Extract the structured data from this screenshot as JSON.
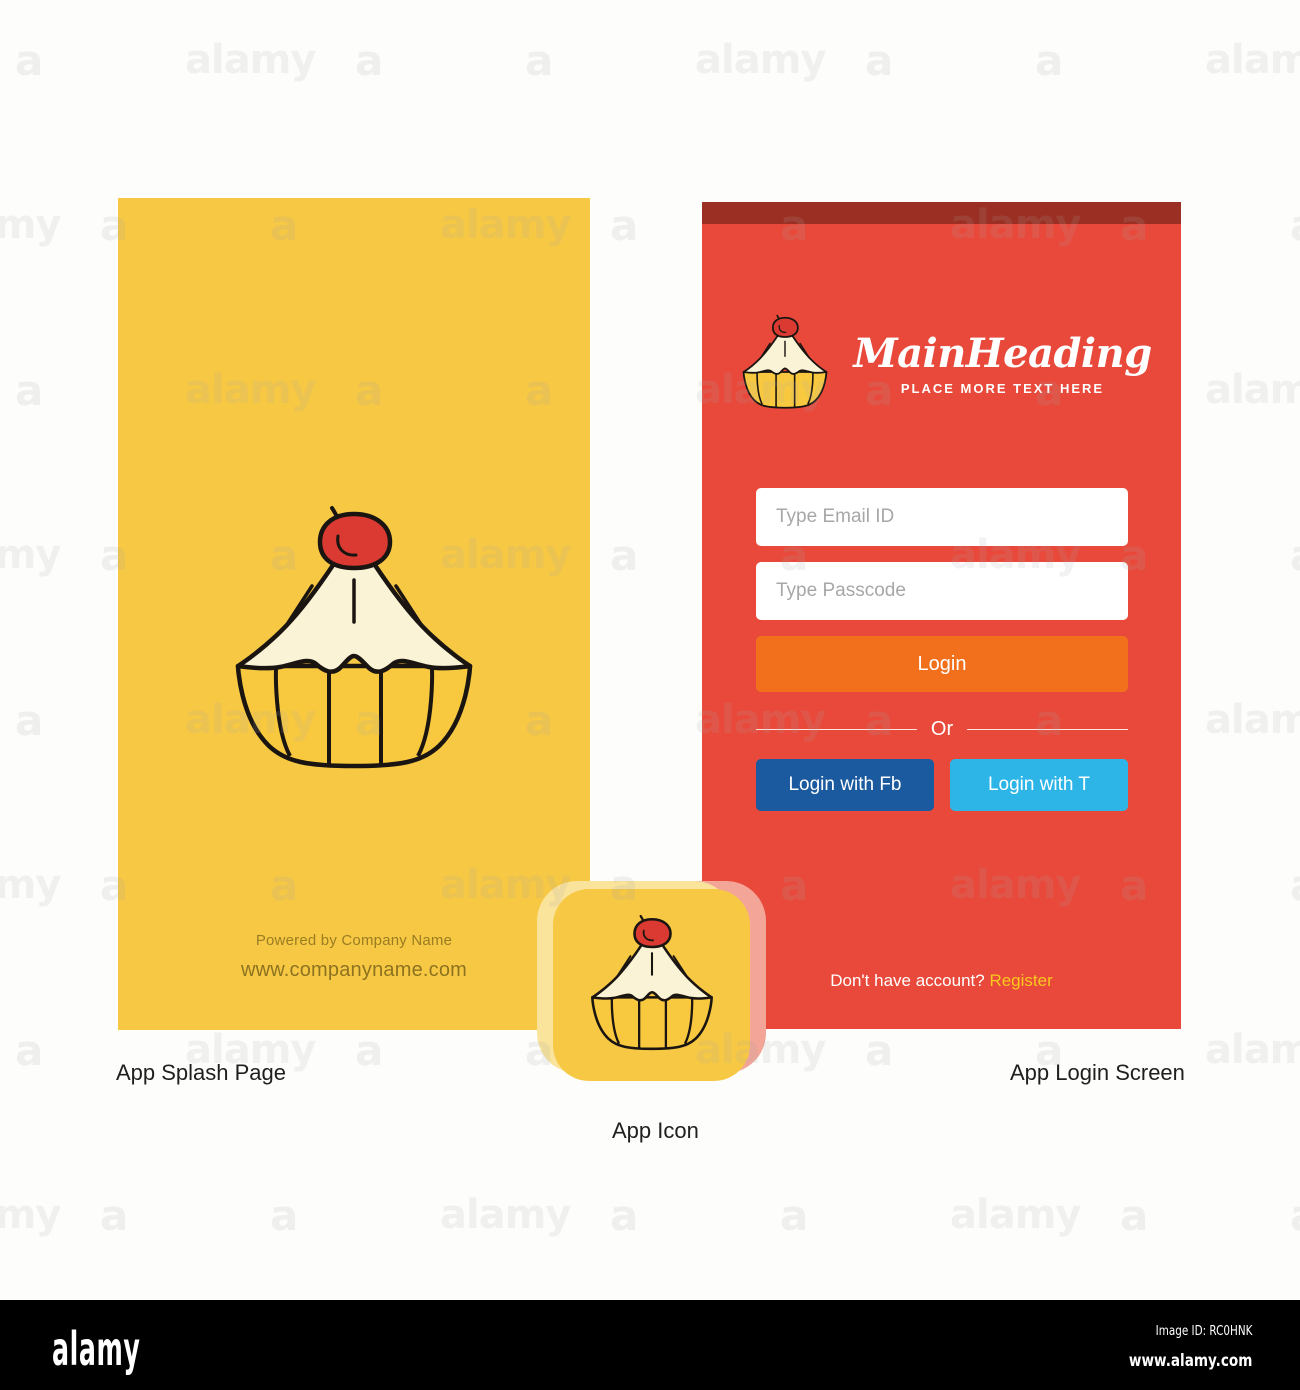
{
  "meta": {
    "colors": {
      "splash_yellow": "#F7C843",
      "login_red": "#E8493A",
      "statusbar_dark_red": "#9C2F23",
      "login_button_orange": "#F2701B",
      "facebook_blue": "#1B5A9E",
      "twitter_blue": "#2EB5E8",
      "register_yellow": "#FAC81E",
      "cherry_red": "#DA3A31",
      "frosting_cream": "#FBF3D6",
      "cup_yellow": "#F8C93F",
      "outline_black": "#1A1511"
    }
  },
  "splash": {
    "icon_name": "cupcake-illustration",
    "powered_by": "Powered by Company Name",
    "website": "www.companyname.com",
    "caption": "App Splash Page"
  },
  "login": {
    "caption": "App Login Screen",
    "brand": {
      "logo_name": "cupcake-logo-icon",
      "heading": "MainHeading",
      "subheading": "PLACE MORE TEXT HERE"
    },
    "form": {
      "email_placeholder": "Type Email ID",
      "email_value": "",
      "passcode_placeholder": "Type Passcode",
      "passcode_value": "",
      "login_label": "Login"
    },
    "divider_label": "Or",
    "social": {
      "facebook_label": "Login with Fb",
      "twitter_label": "Login with T"
    },
    "register": {
      "question": "Don't have account?",
      "link": "Register"
    }
  },
  "app_icon": {
    "icon_name": "cupcake-app-icon",
    "caption": "App Icon"
  },
  "footer": {
    "logo": "alamy",
    "image_id": "Image ID: RC0HNK",
    "url": "www.alamy.com"
  },
  "watermark": {
    "letter": "a",
    "word": "alamy"
  }
}
